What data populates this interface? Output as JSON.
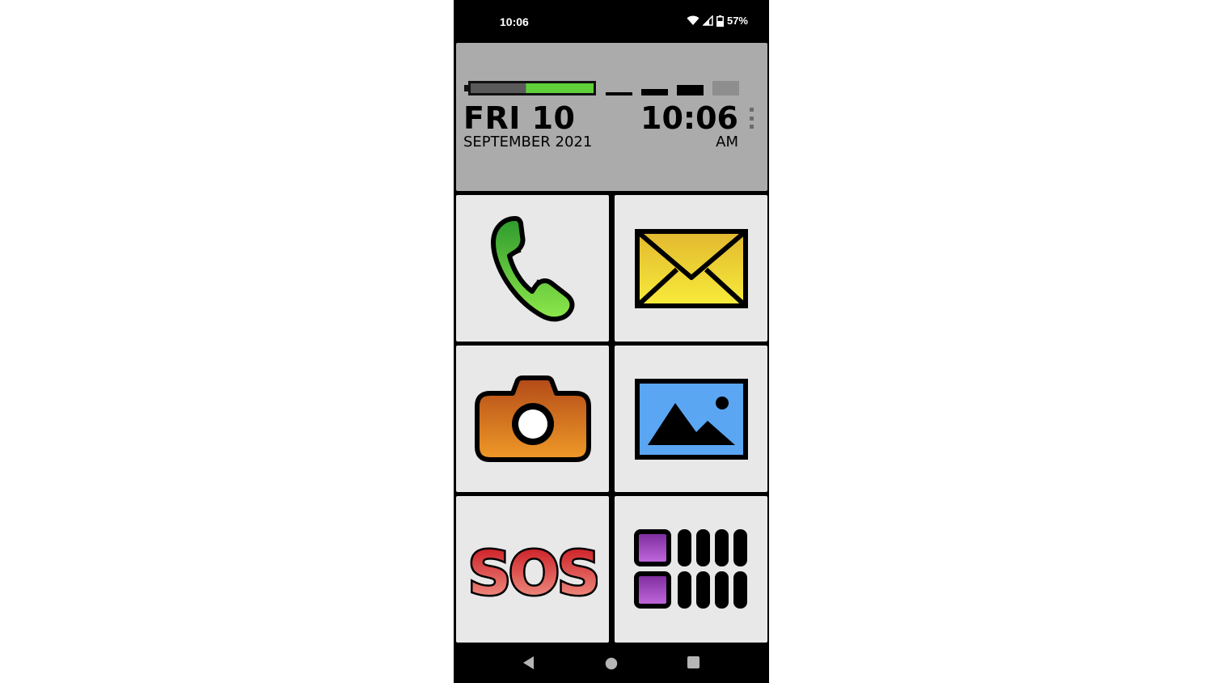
{
  "status_bar": {
    "time": "10:06",
    "battery_percent": "57%",
    "icons": [
      "wifi-icon",
      "cell-signal-icon",
      "battery-icon"
    ]
  },
  "widget": {
    "battery_level_fraction": 0.55,
    "signal_bars_active": 3,
    "day": "FRI 10",
    "month_year": "SEPTEMBER 2021",
    "time": "10:06",
    "ampm": "AM",
    "colors": {
      "background": "#ababab",
      "battery_fill": "#5fd03a"
    }
  },
  "tiles": [
    {
      "name": "phone",
      "icon": "phone-icon"
    },
    {
      "name": "messages",
      "icon": "envelope-icon"
    },
    {
      "name": "camera",
      "icon": "camera-icon"
    },
    {
      "name": "gallery",
      "icon": "picture-icon"
    },
    {
      "name": "sos",
      "icon": "sos-icon",
      "label": "SOS"
    },
    {
      "name": "apps",
      "icon": "apps-grid-icon"
    }
  ],
  "nav": {
    "icons": [
      "back-icon",
      "home-icon",
      "recents-icon"
    ]
  }
}
